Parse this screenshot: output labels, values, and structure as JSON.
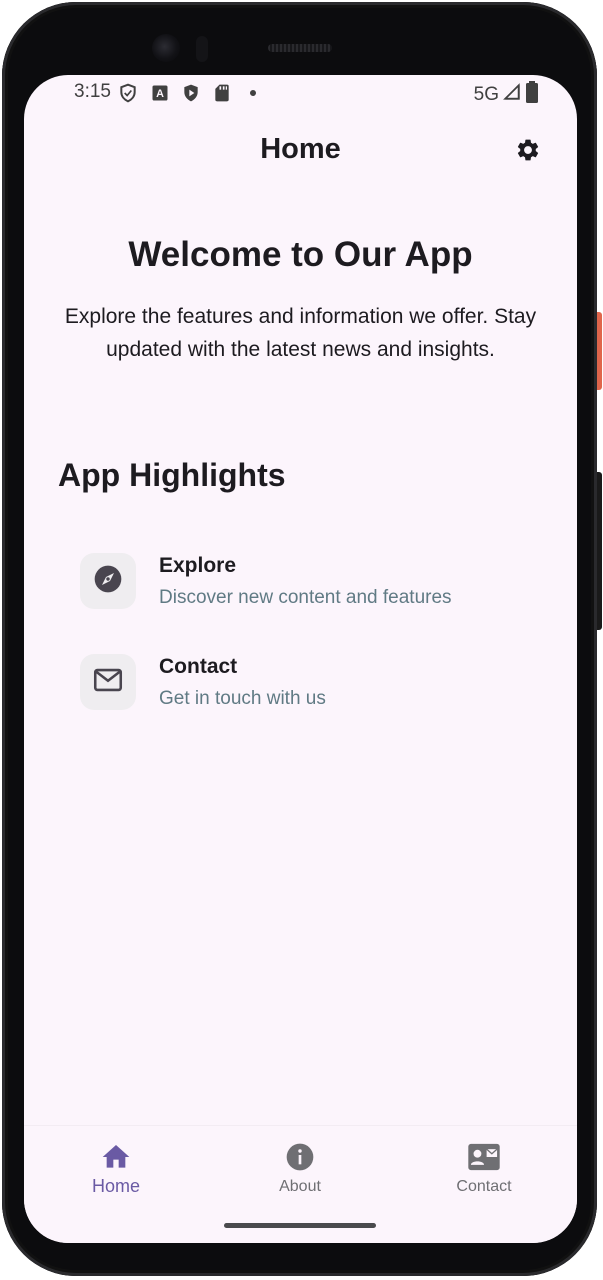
{
  "status_bar": {
    "time": "3:15",
    "network": "5G",
    "icons": [
      "shield-icon",
      "a-badge-icon",
      "play-shield-icon",
      "sd-card-icon",
      "dot-icon",
      "signal-icon",
      "battery-icon"
    ]
  },
  "app_bar": {
    "title": "Home",
    "settings_icon": "gear-icon"
  },
  "welcome": {
    "title": "Welcome to Our App",
    "description": "Explore the features and information we offer. Stay updated with the latest news and insights."
  },
  "highlights": {
    "title": "App Highlights",
    "items": [
      {
        "title": "Explore",
        "subtitle": "Discover new content and features",
        "icon": "compass-icon"
      },
      {
        "title": "Contact",
        "subtitle": "Get in touch with us",
        "icon": "mail-icon"
      }
    ]
  },
  "bottom_nav": {
    "items": [
      {
        "label": "Home",
        "icon": "home-icon",
        "active": true
      },
      {
        "label": "About",
        "icon": "info-icon",
        "active": false
      },
      {
        "label": "Contact",
        "icon": "contact-card-icon",
        "active": false
      }
    ]
  },
  "colors": {
    "background": "#fcf5fc",
    "text_primary": "#1d1b20",
    "text_secondary": "#607a84",
    "accent": "#6a5aa4",
    "icon_box": "#efedf0"
  }
}
